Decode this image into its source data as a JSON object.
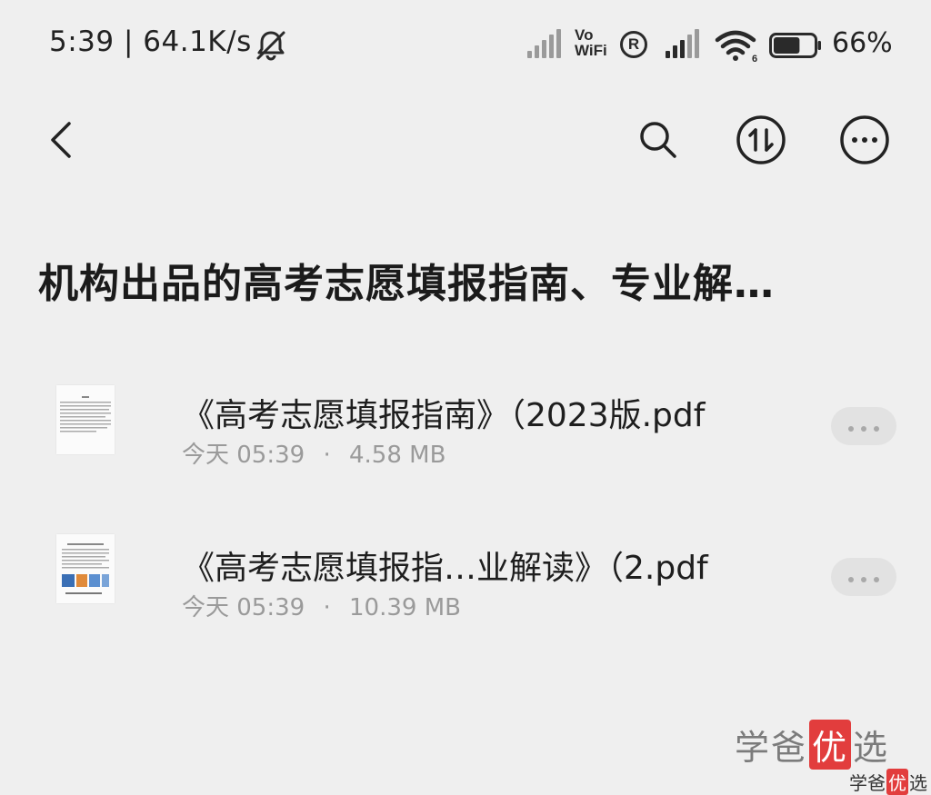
{
  "status_bar": {
    "time": "5:39 | 64.1K/s",
    "mute_icon": "bell-mute-icon",
    "vowifi_top": "Vo",
    "vowifi_bottom": "WiFi",
    "registered": "R",
    "wifi_badge": "6",
    "battery_text": "66%",
    "battery_level": 0.66
  },
  "toolbar": {
    "back_icon": "chevron-left-icon",
    "search_icon": "search-icon",
    "sort_icon": "sort-icon",
    "more_icon": "more-icon"
  },
  "title": "机构出品的高考志愿填报指南、专业解…",
  "files": [
    {
      "name": "《高考志愿填报指南》（2023版.pdf",
      "date": "今天 05:39",
      "separator": "·",
      "size": "4.58 MB"
    },
    {
      "name": "《高考志愿填报指…业解读》（2.pdf",
      "date": "今天 05:39",
      "separator": "·",
      "size": "10.39 MB"
    }
  ],
  "watermark": {
    "part1": "学爸",
    "highlight": "优",
    "part2": "选"
  },
  "colors": {
    "background": "#efefef",
    "text": "#1b1b1b",
    "meta": "#9a9a9a",
    "watermark_red": "#e23d3d"
  }
}
